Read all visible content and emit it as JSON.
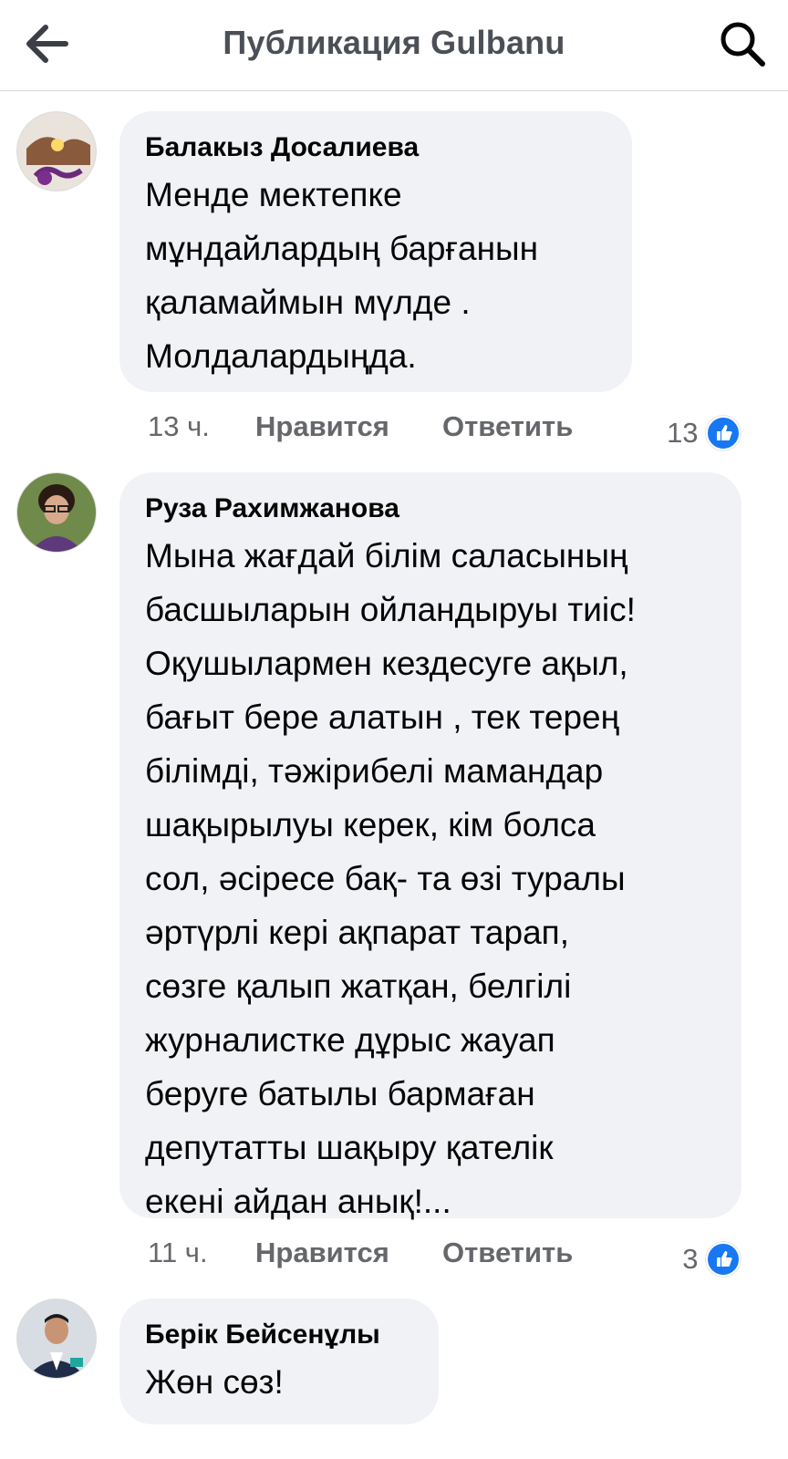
{
  "header": {
    "title": "Публикация Gulbanu",
    "back_icon": "arrow-left-icon",
    "search_icon": "search-icon"
  },
  "comments": [
    {
      "author": "Балакыз Досалиева",
      "text": "Менде мектепке\nмұндайлардың барғанын\nқаламаймын мүлде .\nМолдалардыңда.",
      "time": "13 ч.",
      "like_label": "Нравится",
      "reply_label": "Ответить",
      "likes": "13"
    },
    {
      "author": "Руза Рахимжанова",
      "text": "Мына жағдай білім саласының\nбасшыларын ойландыруы тиіс!\nОқушылармен кездесуге ақыл,\nбағыт бере алатын , тек терең\nбілімді, тәжірибелі мамандар\nшақырылуы керек, кім болса\nсол, әсіресе бақ- та өзі туралы\nәртүрлі кері ақпарат тарап,\nсөзге қалып жатқан, белгілі\nжурналистке дұрыс жауап\nберуге батылы бармаған\nдепутатты шақыру қателік\nекені айдан анық!...",
      "time": "11 ч.",
      "like_label": "Нравится",
      "reply_label": "Ответить",
      "likes": "3"
    },
    {
      "author": "Берік Бейсенұлы",
      "text": "Жөн сөз!"
    }
  ],
  "colors": {
    "like_blue": "#1877f2",
    "bubble_bg": "#f0f2f5",
    "meta_gray": "#65676b"
  }
}
